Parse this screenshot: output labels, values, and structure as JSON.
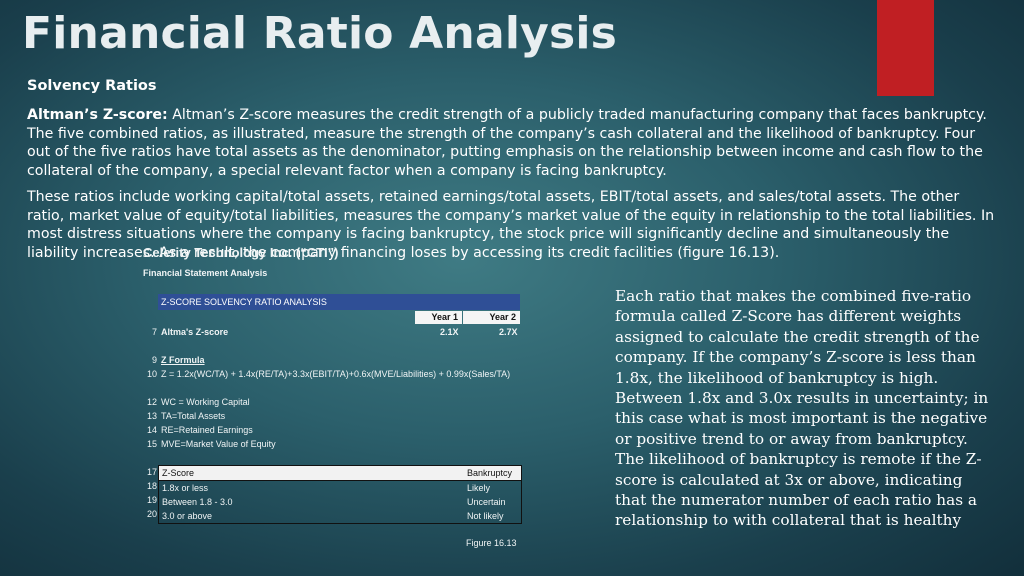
{
  "slide": {
    "title": "Financial Ratio Analysis",
    "subhead": "Solvency Ratios",
    "p1_bold": "Altman’s Z-score:",
    "p1_rest": " Altman’s Z-score measures the credit strength of a publicly traded manufacturing company that faces bankruptcy. The five combined ratios, as illustrated, measure the strength of the company’s cash collateral and the likelihood of bankruptcy. Four out of the five ratios have total assets as the denominator, putting emphasis on the relationship between income and cash flow to the collateral of the company, a special relevant factor when a company is facing bankruptcy.",
    "p2": "These ratios include working capital/total assets, retained earnings/total assets, EBIT/total assets, and sales/total assets. The other ratio, market value of equity/total liabilities, measures the company’s market value of the equity in relationship to the total liabilities. In most distress situations where the company is facing bankruptcy, the stock price will significantly decline and simultaneously the liability increases. As a result, the company financing loses by accessing its credit facilities (figure 16.13).",
    "side_text": "Each ratio that makes the combined five-ratio formula called Z-Score has different weights assigned to calculate the credit strength of the company. If the company’s Z-score is less than 1.8x, the likelihood of bankruptcy is high. Between 1.8x and 3.0x results in uncertainty; in this case what is most important is the negative or positive trend to or away from bankruptcy. The likelihood of bankruptcy is remote if the Z-score is calculated at 3x or above, indicating that the numerator number of each ratio has a relationship to with collateral that is healthy",
    "accent_color": "#c01f23"
  },
  "sheet": {
    "company": "Celerity Technology Inc. (“CTI”)",
    "subtitle": "Financial Statement Analysis",
    "header": "Z-SCORE SOLVENCY RATIO ANALYSIS",
    "year1": "Year  1",
    "year2": "Year 2",
    "r7_num": "7",
    "r7_label": "Altma's Z-score",
    "r7_y1": "2.1X",
    "r7_y2": "2.7X",
    "r9_num": "9",
    "r9_label": "Z Formula",
    "r10_num": "10",
    "r10_label": "Z = 1.2x(WC/TA) + 1.4x(RE/TA)+3.3x(EBIT/TA)+0.6x(MVE/Liabilities) + 0.99x(Sales/TA)",
    "r12_num": "12",
    "r12_label": "WC = Working Capital",
    "r13_num": "13",
    "r13_label": "TA=Total Assets",
    "r14_num": "14",
    "r14_label": "RE=Retained Earnings",
    "r15_num": "15",
    "r15_label": "MVE=Market Value of Equity",
    "table": {
      "h_num": "17",
      "h_left": "Z-Score",
      "h_right": "Bankruptcy",
      "rows": [
        {
          "num": "18",
          "left": "1.8x or less",
          "right": "Likely"
        },
        {
          "num": "19",
          "left": "Between 1.8 - 3.0",
          "right": "Uncertain"
        },
        {
          "num": "20",
          "left": "3.0 or above",
          "right": "Not likely"
        }
      ]
    },
    "figure": "Figure 16.13"
  }
}
